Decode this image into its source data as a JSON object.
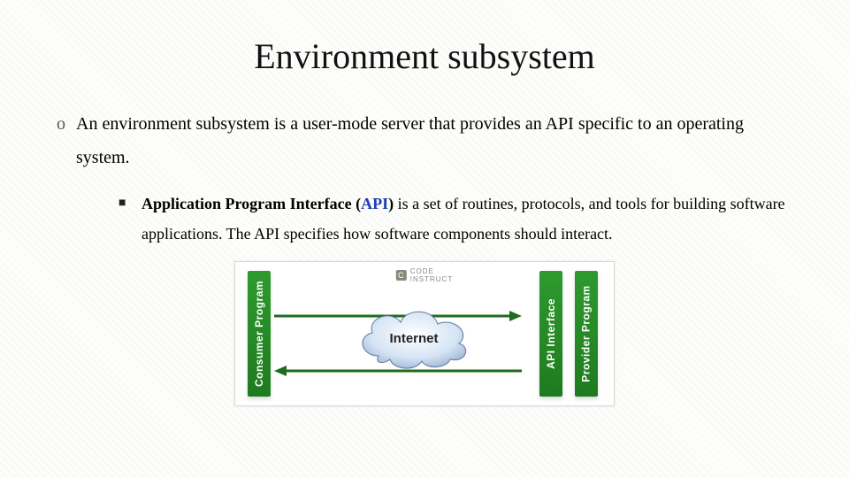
{
  "title": "Environment subsystem",
  "bullets": {
    "lvl1_marker": "o",
    "lvl1_text": "An environment subsystem is a user-mode server that provides an API specific to an operating system.",
    "lvl2_marker": "■",
    "api_bold_before": "Application Program Interface (",
    "api_link": "API",
    "api_bold_after": ")",
    "lvl2_rest": " is a set of routines, protocols, and tools for building software applications. The API specifies how software components should interact."
  },
  "diagram": {
    "consumer": "Consumer Program",
    "api": "API Interface",
    "provider": "Provider Program",
    "center": "Internet",
    "logo_letter": "C",
    "logo_line1": "CODE",
    "logo_line2": "INSTRUCT"
  }
}
